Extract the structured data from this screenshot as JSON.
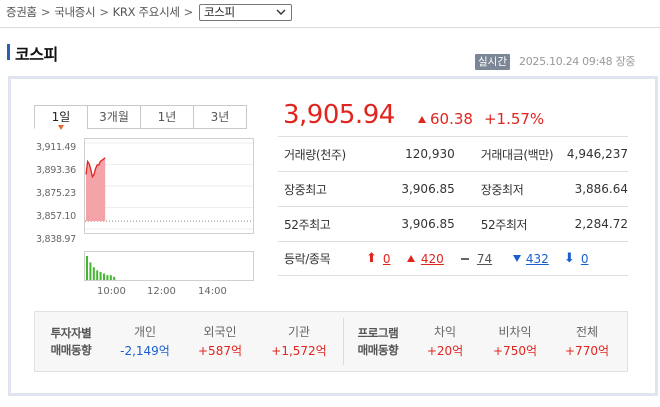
{
  "breadcrumb": {
    "items": [
      "증권홈",
      "국내증시",
      "KRX 주요시세"
    ],
    "separator": ">",
    "select_value": "코스피"
  },
  "title": "코스피",
  "realtime_badge": "실시간",
  "timestamp": "2025.10.24 09:48 장중",
  "tabs": [
    {
      "label": "1일",
      "active": true
    },
    {
      "label": "3개월",
      "active": false
    },
    {
      "label": "1년",
      "active": false
    },
    {
      "label": "3년",
      "active": false
    }
  ],
  "chart_data": {
    "type": "line",
    "x_labels": [
      "10:00",
      "12:00",
      "14:00"
    ],
    "y_ticks": [
      "3,911.49",
      "3,893.36",
      "3,875.23",
      "3,857.10",
      "3,838.97"
    ],
    "y_range": [
      3838.97,
      3911.49
    ],
    "baseline": 3845.56,
    "series": [
      {
        "values": [
          3885.0,
          3896.0,
          3894.0,
          3889.0,
          3883.0,
          3885.0,
          3890.0,
          3893.0,
          3893.0,
          3896.0,
          3897.0,
          3898.0,
          3899.0
        ]
      }
    ],
    "volume": [
      15,
      11,
      8,
      6,
      5,
      4,
      3,
      3,
      2
    ]
  },
  "price": {
    "value": "3,905.94",
    "change": "60.38",
    "percent": "+1.57%",
    "direction": "up"
  },
  "stats": {
    "volume_label": "거래량(천주)",
    "volume": "120,930",
    "amount_label": "거래대금(백만)",
    "amount": "4,946,237",
    "intraday_high_label": "장중최고",
    "intraday_high": "3,906.85",
    "intraday_low_label": "장중최저",
    "intraday_low": "3,886.64",
    "week52_high_label": "52주최고",
    "week52_high": "3,906.85",
    "week52_low_label": "52주최저",
    "week52_low": "2,284.72",
    "updown_label": "등락/종목",
    "upper_limit": "0",
    "up": "420",
    "flat": "74",
    "down": "432",
    "lower_limit": "0"
  },
  "investors": {
    "group1_head": [
      "투자자별",
      "매매동향"
    ],
    "individual_label": "개인",
    "individual_value": "-2,149억",
    "foreign_label": "외국인",
    "foreign_value": "+587억",
    "institution_label": "기관",
    "institution_value": "+1,572억",
    "group2_head": [
      "프로그램",
      "매매동향"
    ],
    "arbitrage_label": "차익",
    "arbitrage_value": "+20억",
    "nonarbitrage_label": "비차익",
    "nonarbitrage_value": "+750억",
    "total_label": "전체",
    "total_value": "+770억"
  },
  "colors": {
    "up": "#e0241e",
    "down": "#1a5fd0",
    "accent": "#2a5fb2",
    "volume_bar": "#41b62f",
    "area_fill": "#f4a3a8"
  }
}
